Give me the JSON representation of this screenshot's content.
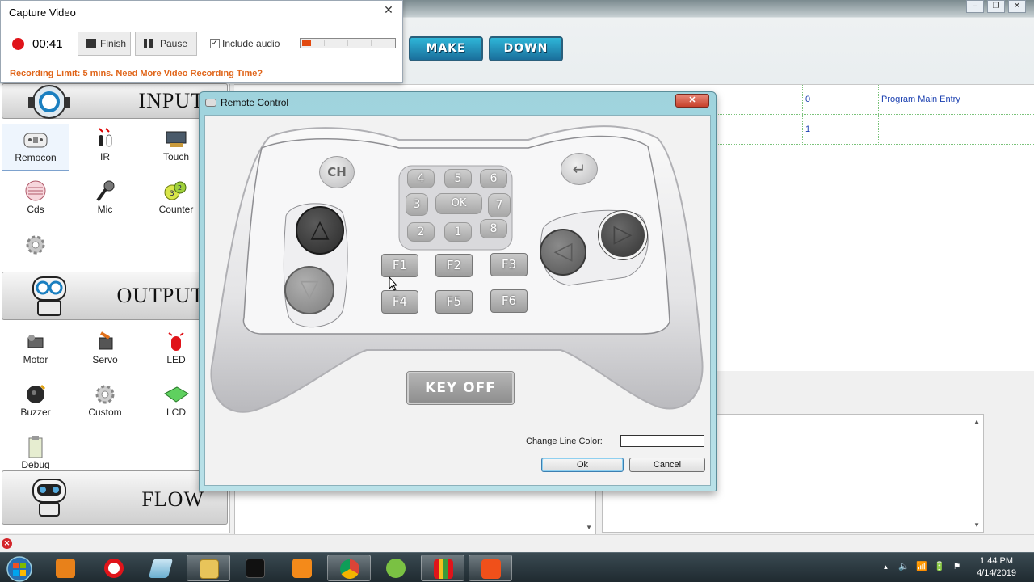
{
  "capture": {
    "title": "Capture Video",
    "timer": "00:41",
    "finish_label": "Finish",
    "pause_label": "Pause",
    "audio_label": "Include audio",
    "audio_checked": true,
    "audio_level": 0.1,
    "limit_text": "Recording Limit: 5 mins. Need More Video Recording Time?",
    "minimize_glyph": "—",
    "close_glyph": "✕"
  },
  "background_app": {
    "toolbar_buttons": [
      "MAKE",
      "DOWN"
    ],
    "window_controls": [
      "–",
      "❐",
      "✕"
    ],
    "table": {
      "rows": [
        {
          "num": "0",
          "desc": "Program Main Entry"
        },
        {
          "num": "1",
          "desc": ""
        }
      ]
    }
  },
  "toolbox": {
    "categories": [
      {
        "title": "INPUT",
        "tools": [
          {
            "label": "Remocon",
            "selected": true
          },
          {
            "label": "IR"
          },
          {
            "label": "Touch"
          },
          {
            "label": "Cds"
          },
          {
            "label": "Mic"
          },
          {
            "label": "Counter"
          }
        ]
      },
      {
        "title": "OUTPUT",
        "tools": [
          {
            "label": "Motor"
          },
          {
            "label": "Servo"
          },
          {
            "label": "LED"
          },
          {
            "label": "Buzzer"
          },
          {
            "label": "Custom"
          },
          {
            "label": "LCD"
          },
          {
            "label": "Debug"
          }
        ]
      },
      {
        "title": "FLOW"
      }
    ]
  },
  "remote": {
    "title": "Remote Control",
    "close_glyph": "✕",
    "ch_label": "CH",
    "enter_glyph": "↵",
    "numpad": {
      "row1": [
        "4",
        "5",
        "6"
      ],
      "row2_left": "3",
      "ok": "OK",
      "row2_right": "7",
      "row3": [
        "2",
        "1",
        "8"
      ]
    },
    "up_glyph": "△",
    "down_glyph": "▽",
    "left_glyph": "◁",
    "right_glyph": "▷",
    "f_buttons": [
      "F1",
      "F2",
      "F3",
      "F4",
      "F5",
      "F6"
    ],
    "key_off_label": "KEY OFF",
    "line_color_label": "Change Line Color:",
    "ok_label": "Ok",
    "cancel_label": "Cancel"
  },
  "status": {
    "error_glyph": "✕"
  },
  "taskbar": {
    "clock_time": "1:44 PM",
    "clock_date": "4/14/2019",
    "tray_glyphs": [
      "▲",
      "🔈",
      "📶",
      "🔋",
      "⚑"
    ]
  },
  "colors": {
    "record_red": "#e0141a",
    "limit_orange": "#e06418",
    "table_text_blue": "#1a3fb0"
  }
}
